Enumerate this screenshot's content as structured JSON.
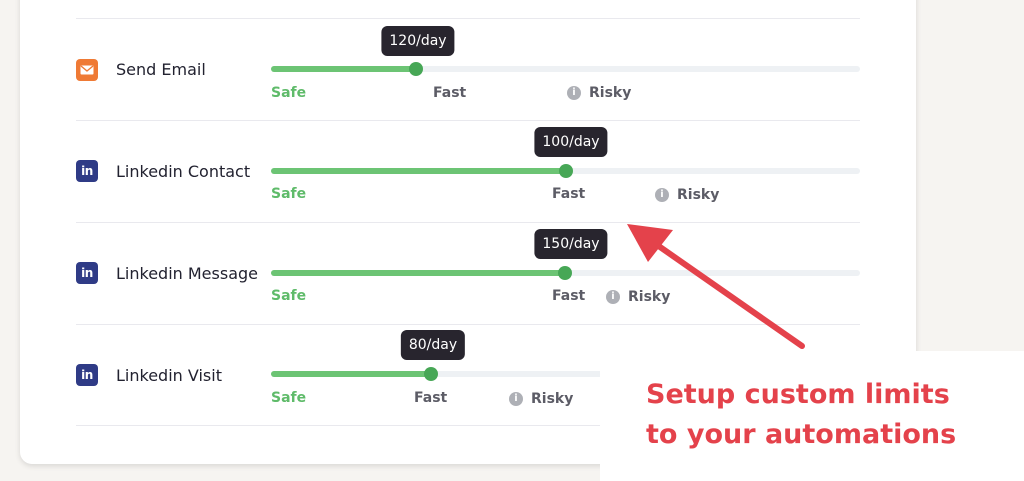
{
  "colors": {
    "accent_green": "#6cc474",
    "knob_green": "#47a756",
    "tooltip_bg": "#28252e",
    "promo_red": "#e4424b",
    "email_orange": "#ef7a35",
    "linkedin_blue": "#2f3b86"
  },
  "rows": [
    {
      "label": "Send Email",
      "icon": "email-icon",
      "value_label": "120/day",
      "value": 120,
      "fill_fraction": 0.246,
      "scale": {
        "safe": "Safe",
        "fast": "Fast",
        "risky": "Risky"
      }
    },
    {
      "label": "Linkedin Contact",
      "icon": "linkedin-icon",
      "value_label": "100/day",
      "value": 100,
      "fill_fraction": 0.501,
      "scale": {
        "safe": "Safe",
        "fast": "Fast",
        "risky": "Risky"
      }
    },
    {
      "label": "Linkedin Message",
      "icon": "linkedin-icon",
      "value_label": "150/day",
      "value": 150,
      "fill_fraction": 0.499,
      "scale": {
        "safe": "Safe",
        "fast": "Fast",
        "risky": "Risky"
      }
    },
    {
      "label": "Linkedin Visit",
      "icon": "linkedin-icon",
      "value_label": "80/day",
      "value": 80,
      "fill_fraction": 0.272,
      "scale": {
        "safe": "Safe",
        "fast": "Fast",
        "risky": "Risky"
      }
    }
  ],
  "promo": {
    "line1": "Setup custom limits",
    "line2": "to your automations"
  }
}
